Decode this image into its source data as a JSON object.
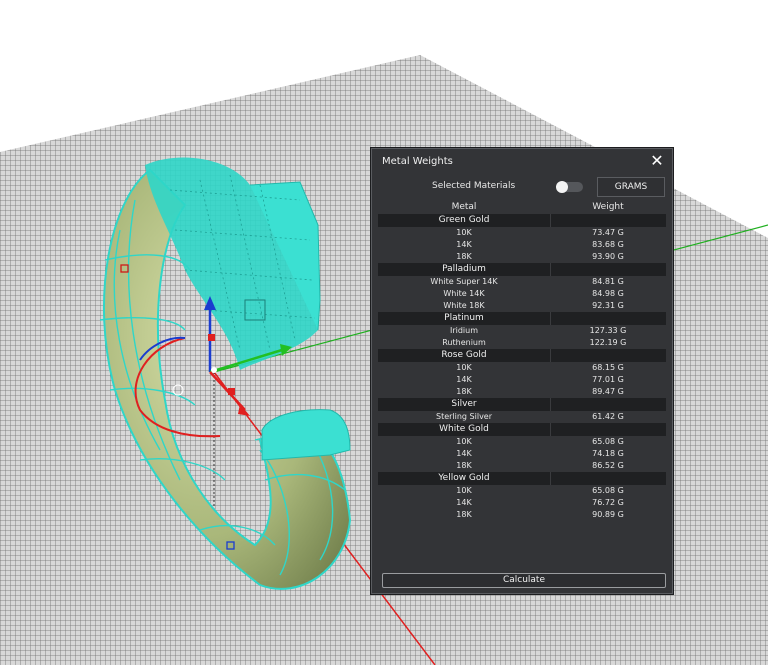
{
  "panel": {
    "title": "Metal Weights",
    "close_icon": "✕",
    "selected_materials_label": "Selected Materials",
    "units_button": "GRAMS",
    "columns": {
      "metal": "Metal",
      "weight": "Weight"
    },
    "calculate_label": "Calculate",
    "groups": [
      {
        "name": "Green Gold",
        "items": [
          {
            "name": "10K",
            "weight": "73.47 G"
          },
          {
            "name": "14K",
            "weight": "83.68 G"
          },
          {
            "name": "18K",
            "weight": "93.90 G"
          }
        ]
      },
      {
        "name": "Palladium",
        "items": [
          {
            "name": "White Super 14K",
            "weight": "84.81 G"
          },
          {
            "name": "White 14K",
            "weight": "84.98 G"
          },
          {
            "name": "White 18K",
            "weight": "92.31 G"
          }
        ]
      },
      {
        "name": "Platinum",
        "items": [
          {
            "name": "Iridium",
            "weight": "127.33 G"
          },
          {
            "name": "Ruthenium",
            "weight": "122.19 G"
          }
        ]
      },
      {
        "name": "Rose Gold",
        "items": [
          {
            "name": "10K",
            "weight": "68.15 G"
          },
          {
            "name": "14K",
            "weight": "77.01 G"
          },
          {
            "name": "18K",
            "weight": "89.47 G"
          }
        ]
      },
      {
        "name": "Silver",
        "items": [
          {
            "name": "Sterling Silver",
            "weight": "61.42 G"
          }
        ]
      },
      {
        "name": "White Gold",
        "items": [
          {
            "name": "10K",
            "weight": "65.08 G"
          },
          {
            "name": "14K",
            "weight": "74.18 G"
          },
          {
            "name": "18K",
            "weight": "86.52 G"
          }
        ]
      },
      {
        "name": "Yellow Gold",
        "items": [
          {
            "name": "10K",
            "weight": "65.08 G"
          },
          {
            "name": "14K",
            "weight": "76.72 G"
          },
          {
            "name": "18K",
            "weight": "90.89 G"
          }
        ]
      }
    ]
  }
}
